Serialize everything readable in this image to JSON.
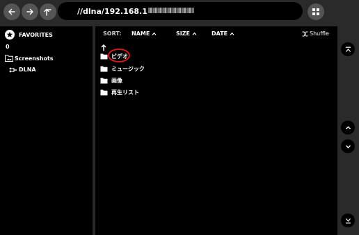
{
  "topbar": {
    "back_icon": "arrow-left-icon",
    "forward_icon": "arrow-right-icon",
    "up_icon": "arrow-up-icon",
    "address_visible": "//dlna/192.168.1",
    "grid_icon": "grid-icon"
  },
  "sidebar": {
    "favorites_label": "FAVORITES",
    "count": "0",
    "items": [
      {
        "label": "Screenshots",
        "icon": "image-folder-icon"
      },
      {
        "label": "DLNA",
        "icon": "network-icon"
      }
    ]
  },
  "sort_bar": {
    "sort_label": "SORT:",
    "name_label": "NAME",
    "size_label": "SIZE",
    "date_label": "DATE",
    "shuffle_label": "Shuffle"
  },
  "files": [
    {
      "name": "ビデオ",
      "icon": "folder-icon",
      "highlighted": true
    },
    {
      "name": "ミュージック",
      "icon": "folder-icon",
      "highlighted": false
    },
    {
      "name": "画像",
      "icon": "folder-icon",
      "highlighted": false
    },
    {
      "name": "再生リスト",
      "icon": "folder-icon",
      "highlighted": false
    }
  ],
  "rail": {
    "top_icon": "scroll-to-top-icon",
    "up_icon": "chevron-up-icon",
    "down_icon": "chevron-down-icon",
    "bottom_icon": "scroll-to-bottom-icon"
  },
  "colors": {
    "background": "#2a2a2a",
    "panel": "#000000",
    "button": "#555555",
    "highlight": "#d01a1a",
    "text": "#ffffff"
  }
}
